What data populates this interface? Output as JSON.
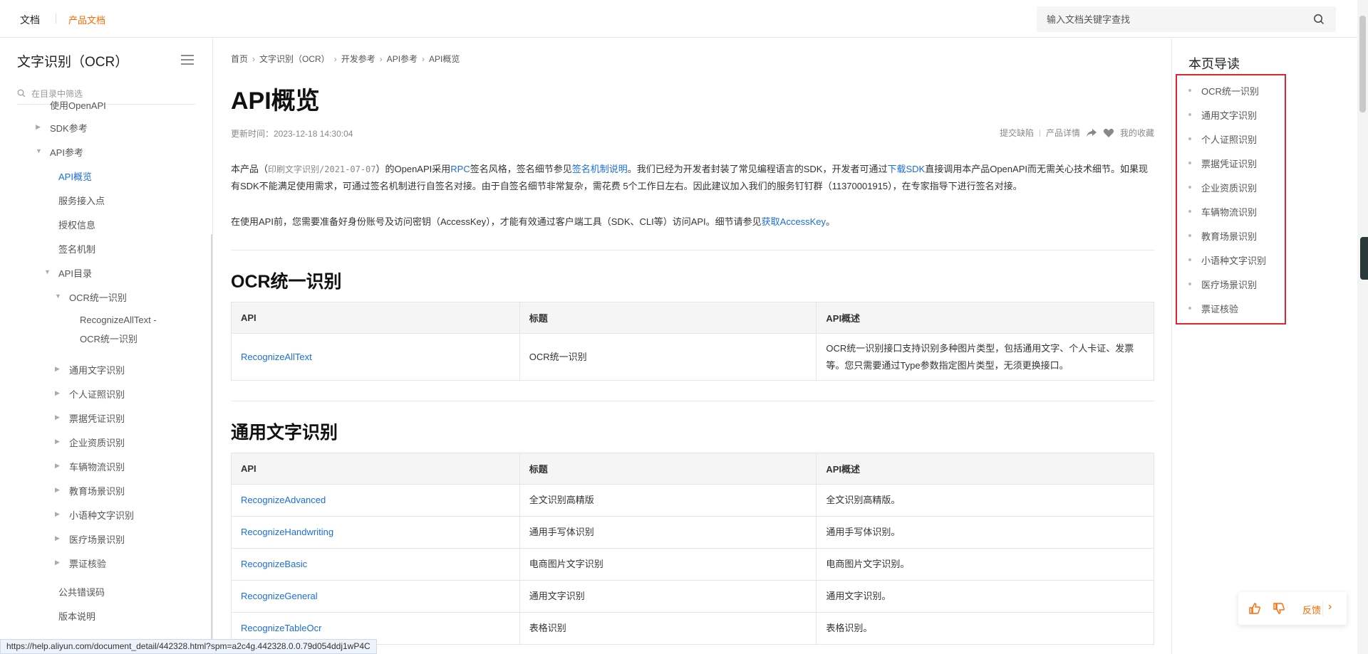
{
  "header": {
    "brand": "文档",
    "sub": "产品文档",
    "search_placeholder": "输入文档关键字查找"
  },
  "sidebar": {
    "title": "文字识别（OCR）",
    "filter_placeholder": "在目录中筛选",
    "items": [
      {
        "label": "使用OpenAPI",
        "level": 1
      },
      {
        "label": "SDK参考",
        "level": 1,
        "caret": "collapsed"
      },
      {
        "label": "API参考",
        "level": 1,
        "caret": "expanded"
      },
      {
        "label": "API概览",
        "level": 2,
        "active": true
      },
      {
        "label": "服务接入点",
        "level": 2
      },
      {
        "label": "授权信息",
        "level": 2
      },
      {
        "label": "签名机制",
        "level": 2
      },
      {
        "label": "API目录",
        "level": 2,
        "caret": "expanded"
      },
      {
        "label": "OCR统一识别",
        "level": 3,
        "caret": "expanded"
      },
      {
        "label": "RecognizeAllText -",
        "level": 4
      },
      {
        "label": "OCR统一识别",
        "level": 4
      },
      {
        "label": "通用文字识别",
        "level": 3,
        "caret": "collapsed"
      },
      {
        "label": "个人证照识别",
        "level": 3,
        "caret": "collapsed"
      },
      {
        "label": "票据凭证识别",
        "level": 3,
        "caret": "collapsed"
      },
      {
        "label": "企业资质识别",
        "level": 3,
        "caret": "collapsed"
      },
      {
        "label": "车辆物流识别",
        "level": 3,
        "caret": "collapsed"
      },
      {
        "label": "教育场景识别",
        "level": 3,
        "caret": "collapsed"
      },
      {
        "label": "小语种文字识别",
        "level": 3,
        "caret": "collapsed"
      },
      {
        "label": "医疗场景识别",
        "level": 3,
        "caret": "collapsed"
      },
      {
        "label": "票证核验",
        "level": 3,
        "caret": "collapsed"
      },
      {
        "label": "公共错误码",
        "level": 2
      },
      {
        "label": "版本说明",
        "level": 2
      }
    ]
  },
  "main": {
    "breadcrumbs": [
      "首页",
      "文字识别（OCR）",
      "开发参考",
      "API参考",
      "API概览"
    ],
    "title": "API概览",
    "updated": "更新时间：2023-12-18 14:30:04",
    "actions": {
      "report": "提交缺陷",
      "detail": "产品详情",
      "fav": "我的收藏"
    },
    "intro": {
      "p1_a": "本产品（",
      "p1_code": "印刷文字识别/2021-07-07",
      "p1_b": "）的OpenAPI采用",
      "p1_rpc": "RPC",
      "p1_c": "签名风格，签名细节参见",
      "p1_sig": "签名机制说明",
      "p1_d": "。我们已经为开发者封装了常见编程语言的SDK，开发者可通过",
      "p1_sdk": "下载SDK",
      "p1_e": "直接调用本产品OpenAPI而无需关心技术细节。如果现有SDK不能满足使用需求，可通过签名机制进行自签名对接。由于自签名细节非常复杂，需花费 5个工作日左右。因此建议加入我们的服务钉钉群（11370001915），在专家指导下进行签名对接。",
      "p2_a": "在使用API前，您需要准备好身份账号及访问密钥（AccessKey），才能有效通过客户端工具（SDK、CLI等）访问API。细节请参见",
      "p2_link": "获取AccessKey",
      "p2_b": "。"
    },
    "table_headers": [
      "API",
      "标题",
      "API概述"
    ],
    "section1": {
      "title": "OCR统一识别",
      "rows": [
        {
          "api": "RecognizeAllText",
          "title": "OCR统一识别",
          "desc": "OCR统一识别接口支持识别多种图片类型，包括通用文字、个人卡证、发票等。您只需要通过Type参数指定图片类型，无须更换接口。"
        }
      ]
    },
    "section2": {
      "title": "通用文字识别",
      "rows": [
        {
          "api": "RecognizeAdvanced",
          "title": "全文识别高精版",
          "desc": "全文识别高精版。"
        },
        {
          "api": "RecognizeHandwriting",
          "title": "通用手写体识别",
          "desc": "通用手写体识别。"
        },
        {
          "api": "RecognizeBasic",
          "title": "电商图片文字识别",
          "desc": "电商图片文字识别。"
        },
        {
          "api": "RecognizeGeneral",
          "title": "通用文字识别",
          "desc": "通用文字识别。"
        },
        {
          "api": "RecognizeTableOcr",
          "title": "表格识别",
          "desc": "表格识别。"
        }
      ]
    }
  },
  "toc": {
    "title": "本页导读",
    "items": [
      "OCR统一识别",
      "通用文字识别",
      "个人证照识别",
      "票据凭证识别",
      "企业资质识别",
      "车辆物流识别",
      "教育场景识别",
      "小语种文字识别",
      "医疗场景识别",
      "票证核验"
    ],
    "highlight_color": "#e0262b"
  },
  "feedback": {
    "label": "反馈"
  },
  "statusbar": {
    "url": "https://help.aliyun.com/document_detail/442328.html?spm=a2c4g.442328.0.0.79d054ddj1wP4C"
  },
  "colors": {
    "accent": "#ff6a00",
    "link": "#1a6ee0"
  }
}
